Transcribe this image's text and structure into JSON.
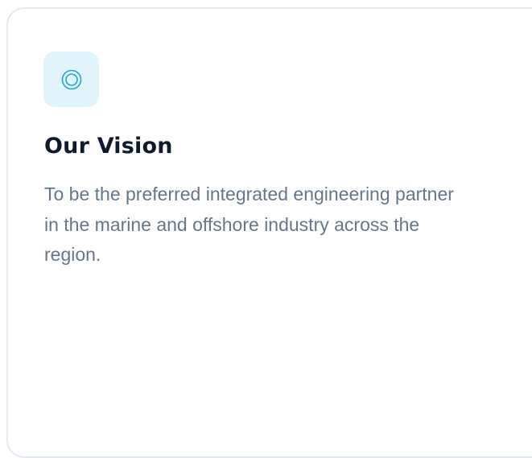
{
  "card": {
    "icon": "target-icon",
    "accent_color": "#1ea7d8",
    "icon_background": "#e1f3fb",
    "title": "Our Vision",
    "description": "To be the preferred integrated engineering partner in the marine and offshore industry across the region."
  }
}
